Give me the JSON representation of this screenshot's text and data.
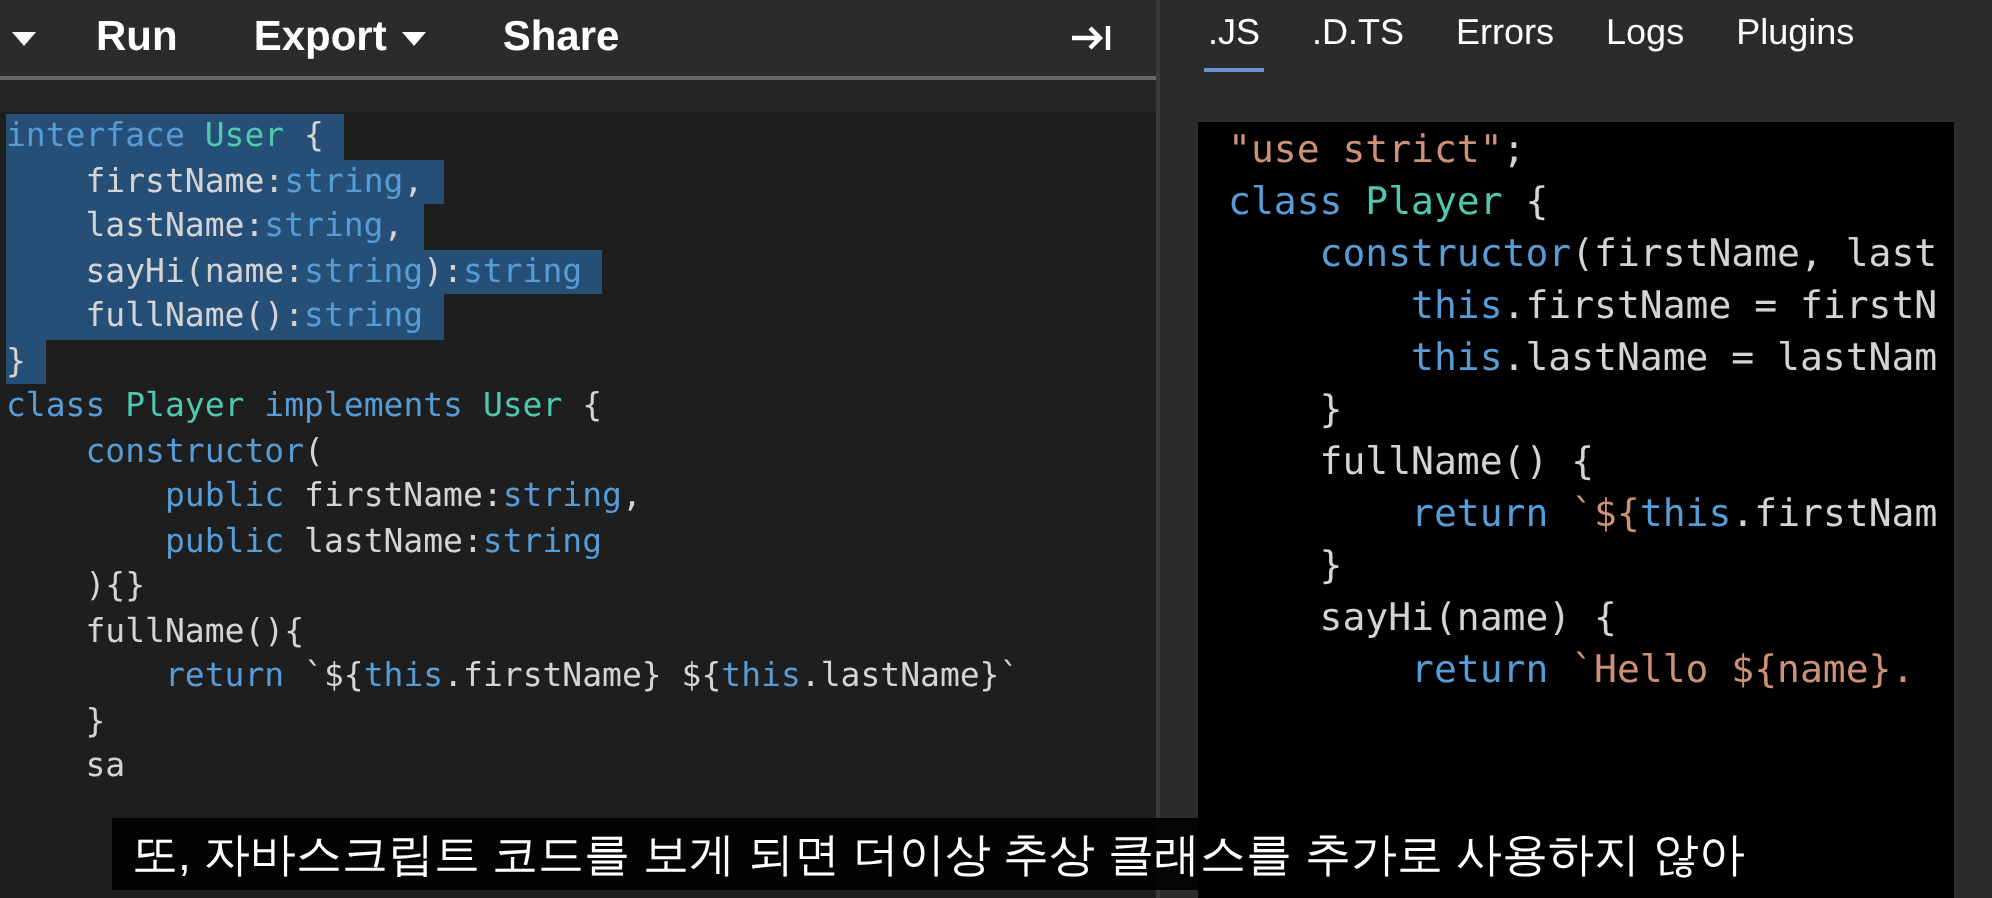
{
  "toolbar": {
    "items": [
      {
        "kind": "caret"
      },
      {
        "kind": "button",
        "label": "Run"
      },
      {
        "kind": "menu",
        "label": "Export"
      },
      {
        "kind": "button",
        "label": "Share"
      }
    ]
  },
  "editor": {
    "lines": [
      {
        "selected": true,
        "tokens": [
          {
            "kind": "kw",
            "text": "interface "
          },
          {
            "kind": "type",
            "text": "User"
          },
          {
            "kind": "plain",
            "text": " {"
          }
        ]
      },
      {
        "selected": true,
        "tokens": [
          {
            "kind": "plain",
            "text": "    firstName:"
          },
          {
            "kind": "kw",
            "text": "string"
          },
          {
            "kind": "plain",
            "text": ","
          }
        ]
      },
      {
        "selected": true,
        "tokens": [
          {
            "kind": "plain",
            "text": "    lastName:"
          },
          {
            "kind": "kw",
            "text": "string"
          },
          {
            "kind": "plain",
            "text": ","
          }
        ]
      },
      {
        "selected": true,
        "tokens": [
          {
            "kind": "plain",
            "text": "    sayHi(name:"
          },
          {
            "kind": "kw",
            "text": "string"
          },
          {
            "kind": "plain",
            "text": "):"
          },
          {
            "kind": "kw",
            "text": "string"
          }
        ]
      },
      {
        "selected": true,
        "tokens": [
          {
            "kind": "plain",
            "text": "    fullName():"
          },
          {
            "kind": "kw",
            "text": "string"
          }
        ]
      },
      {
        "selected": true,
        "tokens": [
          {
            "kind": "plain",
            "text": "}"
          }
        ]
      },
      {
        "selected": false,
        "tokens": [
          {
            "kind": "kw",
            "text": "class "
          },
          {
            "kind": "type",
            "text": "Player "
          },
          {
            "kind": "kw",
            "text": "implements "
          },
          {
            "kind": "type",
            "text": "User"
          },
          {
            "kind": "plain",
            "text": " {"
          }
        ]
      },
      {
        "selected": false,
        "tokens": [
          {
            "kind": "kw",
            "text": "    constructor"
          },
          {
            "kind": "plain",
            "text": "("
          }
        ]
      },
      {
        "selected": false,
        "tokens": [
          {
            "kind": "kw",
            "text": "        public "
          },
          {
            "kind": "plain",
            "text": "firstName:"
          },
          {
            "kind": "kw",
            "text": "string"
          },
          {
            "kind": "plain",
            "text": ","
          }
        ]
      },
      {
        "selected": false,
        "tokens": [
          {
            "kind": "kw",
            "text": "        public "
          },
          {
            "kind": "plain",
            "text": "lastName:"
          },
          {
            "kind": "kw",
            "text": "string"
          }
        ]
      },
      {
        "selected": false,
        "tokens": [
          {
            "kind": "plain",
            "text": "    ){}"
          }
        ]
      },
      {
        "selected": false,
        "tokens": [
          {
            "kind": "plain",
            "text": "    fullName(){"
          }
        ]
      },
      {
        "selected": false,
        "tokens": [
          {
            "kind": "kw",
            "text": "        return "
          },
          {
            "kind": "plain",
            "text": "`${"
          },
          {
            "kind": "kw",
            "text": "this"
          },
          {
            "kind": "plain",
            "text": ".firstName} ${"
          },
          {
            "kind": "kw",
            "text": "this"
          },
          {
            "kind": "plain",
            "text": ".lastName}`"
          }
        ]
      },
      {
        "selected": false,
        "tokens": [
          {
            "kind": "plain",
            "text": "    }"
          }
        ]
      },
      {
        "selected": false,
        "tokens": [
          {
            "kind": "plain",
            "text": "    sa"
          }
        ]
      }
    ]
  },
  "output": {
    "tabs": [
      {
        "label": ".JS",
        "selected": true
      },
      {
        "label": ".D.TS",
        "selected": false
      },
      {
        "label": "Errors",
        "selected": false
      },
      {
        "label": "Logs",
        "selected": false
      },
      {
        "label": "Plugins",
        "selected": false
      }
    ],
    "lines": [
      {
        "tokens": [
          {
            "kind": "str",
            "text": "\"use strict\""
          },
          {
            "kind": "plain",
            "text": ";"
          }
        ]
      },
      {
        "tokens": [
          {
            "kind": "kw",
            "text": "class "
          },
          {
            "kind": "type",
            "text": "Player"
          },
          {
            "kind": "plain",
            "text": " {"
          }
        ]
      },
      {
        "tokens": [
          {
            "kind": "kw",
            "text": "    constructor"
          },
          {
            "kind": "plain",
            "text": "(firstName, last"
          }
        ]
      },
      {
        "tokens": [
          {
            "kind": "kw",
            "text": "        this"
          },
          {
            "kind": "plain",
            "text": ".firstName = firstN"
          }
        ]
      },
      {
        "tokens": [
          {
            "kind": "kw",
            "text": "        this"
          },
          {
            "kind": "plain",
            "text": ".lastName = lastNam"
          }
        ]
      },
      {
        "tokens": [
          {
            "kind": "plain",
            "text": "    }"
          }
        ]
      },
      {
        "tokens": [
          {
            "kind": "plain",
            "text": "    fullName() {"
          }
        ]
      },
      {
        "tokens": [
          {
            "kind": "kw",
            "text": "        return "
          },
          {
            "kind": "str",
            "text": "`${"
          },
          {
            "kind": "kw",
            "text": "this"
          },
          {
            "kind": "plain",
            "text": ".firstNam"
          }
        ]
      },
      {
        "tokens": [
          {
            "kind": "plain",
            "text": "    }"
          }
        ]
      },
      {
        "tokens": [
          {
            "kind": "plain",
            "text": "    sayHi(name) {"
          }
        ]
      },
      {
        "tokens": [
          {
            "kind": "kw",
            "text": "        return "
          },
          {
            "kind": "str",
            "text": "`Hello ${name}. "
          }
        ]
      }
    ]
  },
  "subtitle": "또, 자바스크립트 코드를 보게 되면 더이상 추상 클래스를 추가로 사용하지 않아"
}
